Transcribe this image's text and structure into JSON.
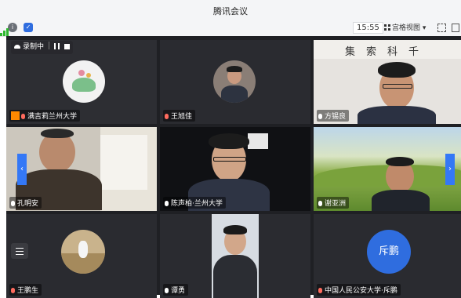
{
  "window": {
    "title": "腾讯会议"
  },
  "toolbar": {
    "info_icon": "info-icon",
    "security_icon": "shield-icon",
    "network_icon": "signal-icon",
    "time": "15:55",
    "view_label": "宫格视图",
    "view_caret": "▾"
  },
  "recording": {
    "label": "录制中"
  },
  "participants": [
    {
      "name": "满吉莉兰州大学",
      "host": true
    },
    {
      "name": "王旭佳"
    },
    {
      "name": "方锡良"
    },
    {
      "name": "孔明安"
    },
    {
      "name": "陈声柏·兰州大学"
    },
    {
      "name": "谢亚洲"
    },
    {
      "name": "王鹏生"
    },
    {
      "name": "谭勇"
    },
    {
      "name": "中国人民公安大学·斥鹏",
      "avatar_text": "斥鹏"
    }
  ],
  "wall_calligraphy": "集索科千",
  "colors": {
    "accent": "#2f6ddf",
    "host_badge": "#ff8a00",
    "page_arrow": "#3478f6",
    "stage": "#1f2024"
  }
}
